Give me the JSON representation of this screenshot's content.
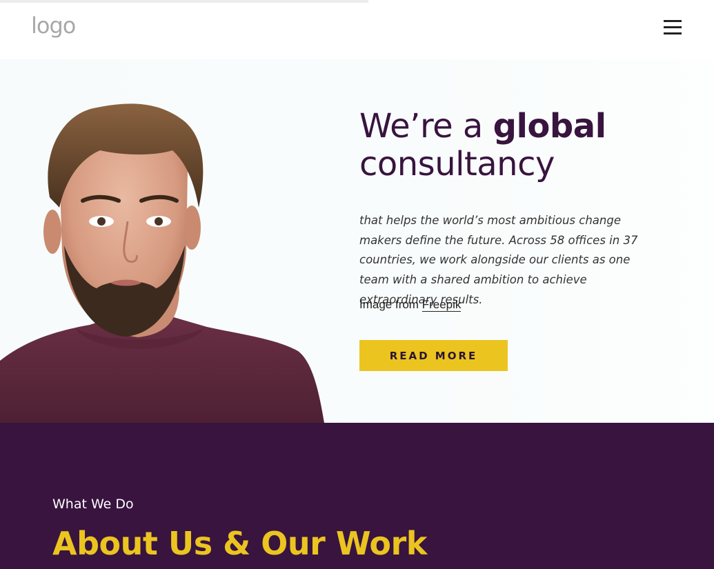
{
  "header": {
    "logo_text": "logo",
    "menu_icon": "hamburger-menu-icon"
  },
  "hero": {
    "headline_part1": "We’re a ",
    "headline_bold": "global",
    "headline_part2": "consultancy",
    "description": "that helps the world’s most ambitious change makers define the future. Across 58 offices in 37 countries, we work alongside our clients as one team with a shared ambition to achieve extraordinary results.",
    "credit_prefix": "Image from ",
    "credit_link": "Freepik",
    "button_label": "READ MORE"
  },
  "about": {
    "eyebrow": "What We Do",
    "title": "About Us & Our Work"
  },
  "colors": {
    "primary": "#38143f",
    "accent": "#ebc420",
    "background": "#ffffff"
  }
}
